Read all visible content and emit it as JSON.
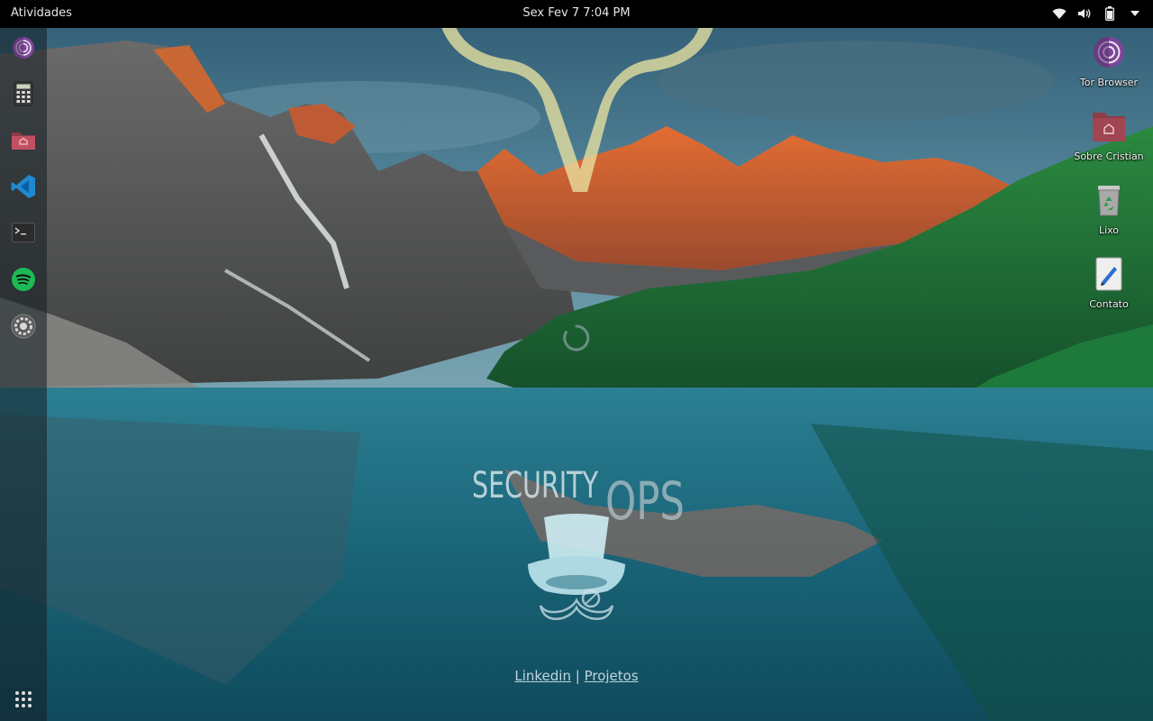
{
  "topbar": {
    "activities_label": "Atividades",
    "clock": "Sex Fev 7  7:04 PM",
    "status_icons": [
      "wifi-icon",
      "volume-icon",
      "battery-icon",
      "system-menu-arrow-icon"
    ]
  },
  "dock": {
    "items": [
      {
        "name": "Tor Browser",
        "icon": "tor-browser-icon"
      },
      {
        "name": "Calculator",
        "icon": "calculator-icon"
      },
      {
        "name": "Files",
        "icon": "home-folder-icon"
      },
      {
        "name": "Visual Studio Code",
        "icon": "vscode-icon"
      },
      {
        "name": "Terminal",
        "icon": "terminal-icon"
      },
      {
        "name": "Spotify",
        "icon": "spotify-icon"
      },
      {
        "name": "Settings",
        "icon": "settings-icon"
      }
    ],
    "show_apps_icon": "app-grid-icon"
  },
  "desktop": {
    "items": [
      {
        "label": "Tor Browser",
        "icon": "tor-browser-icon"
      },
      {
        "label": "Sobre Cristian",
        "icon": "home-folder-icon"
      },
      {
        "label": "Lixo",
        "icon": "trash-icon"
      },
      {
        "label": "Contato",
        "icon": "text-editor-icon"
      }
    ]
  },
  "overlay": {
    "brand_word_1": "SECURITY",
    "brand_word_2": "OPS",
    "link_linkedin": "Linkedin",
    "separator": "|",
    "link_projetos": "Projetos"
  },
  "colors": {
    "topbar": "#000000",
    "sky": "#3f6f86",
    "peaks": "#c8592a",
    "forest": "#1f6a35",
    "lake": "#1a6b7e",
    "logo": "#e8e2a0"
  }
}
